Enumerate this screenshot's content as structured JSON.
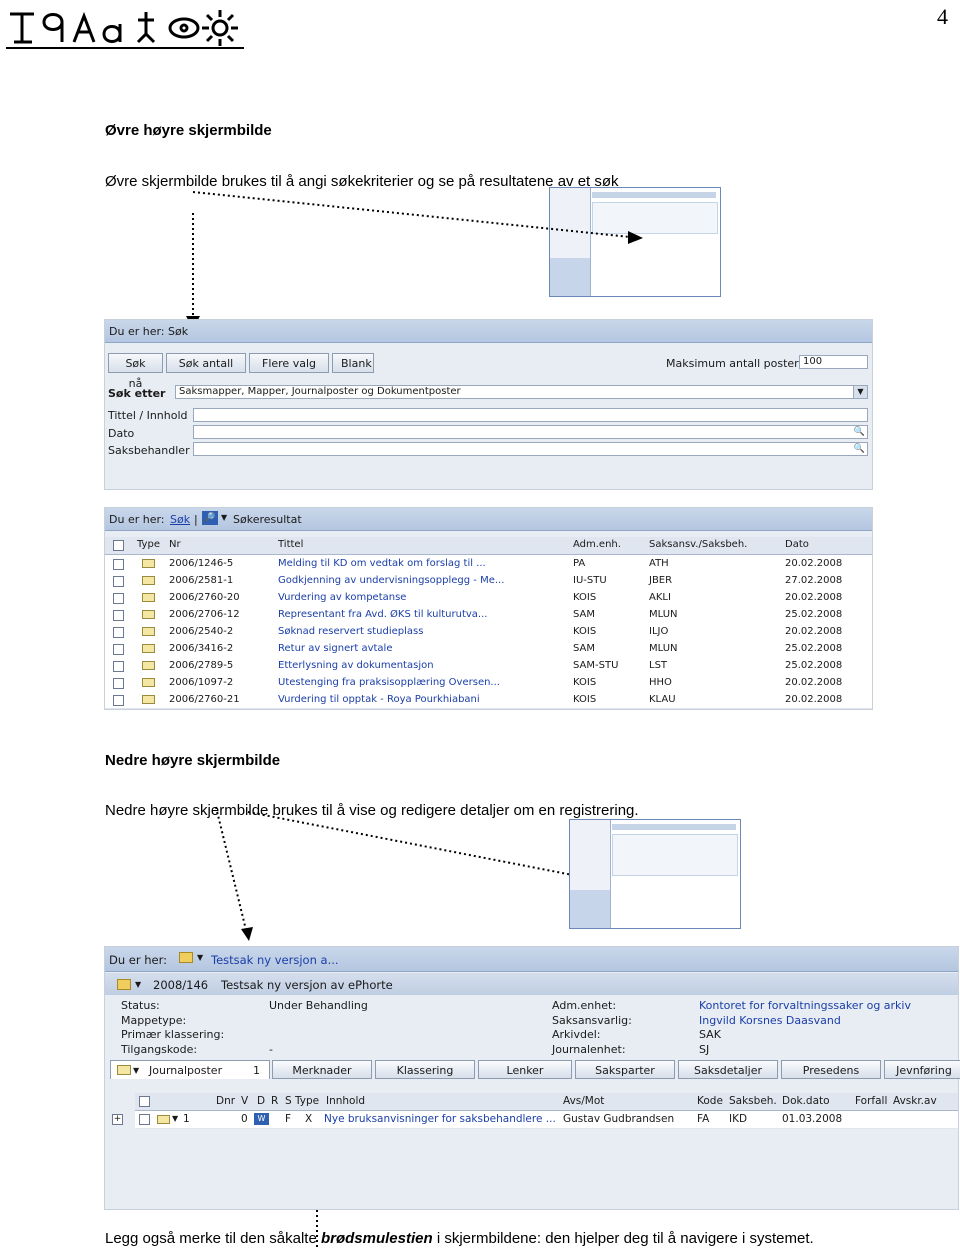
{
  "page_number": "4",
  "section1": {
    "heading": "Øvre høyre skjermbilde",
    "text": "Øvre skjermbilde brukes til å angi søkekriterier og se på resultatene av et søk"
  },
  "search_panel": {
    "breadcrumb": "Du er her: Søk",
    "buttons": [
      "Søk nå",
      "Søk antall",
      "Flere valg",
      "Blank"
    ],
    "max_label": "Maksimum antall poster",
    "max_value": "100",
    "search_for_label": "Søk etter",
    "search_for_value": "Saksmapper, Mapper, Journalposter og Dokumentposter",
    "fields": [
      "Tittel / Innhold",
      "Dato",
      "Saksbehandler"
    ]
  },
  "results_panel": {
    "breadcrumb_prefix": "Du er her:",
    "breadcrumb_link": "Søk",
    "breadcrumb_sep": "|",
    "breadcrumb_current": "Søkeresultat",
    "columns": [
      "Type",
      "Nr",
      "Tittel",
      "Adm.enh.",
      "Saksansv./Saksbeh.",
      "Dato"
    ],
    "rows": [
      {
        "nr": "2006/1246-5",
        "tittel": "Melding til KD om vedtak om forslag til ...",
        "adm": "PA",
        "saksbeh": "ATH",
        "dato": "20.02.2008"
      },
      {
        "nr": "2006/2581-1",
        "tittel": "Godkjenning av undervisningsopplegg - Me...",
        "adm": "IU-STU",
        "saksbeh": "JBER",
        "dato": "27.02.2008"
      },
      {
        "nr": "2006/2760-20",
        "tittel": "Vurdering av kompetanse",
        "adm": "KOIS",
        "saksbeh": "AKLI",
        "dato": "20.02.2008"
      },
      {
        "nr": "2006/2706-12",
        "tittel": "Representant fra Avd. ØKS til kulturutva...",
        "adm": "SAM",
        "saksbeh": "MLUN",
        "dato": "25.02.2008"
      },
      {
        "nr": "2006/2540-2",
        "tittel": "Søknad reservert studieplass",
        "adm": "KOIS",
        "saksbeh": "ILJO",
        "dato": "20.02.2008"
      },
      {
        "nr": "2006/3416-2",
        "tittel": "Retur av signert avtale",
        "adm": "SAM",
        "saksbeh": "MLUN",
        "dato": "25.02.2008"
      },
      {
        "nr": "2006/2789-5",
        "tittel": "Etterlysning av dokumentasjon",
        "adm": "SAM-STU",
        "saksbeh": "LST",
        "dato": "25.02.2008"
      },
      {
        "nr": "2006/1097-2",
        "tittel": "Utestenging fra praksisopplæring Oversen...",
        "adm": "KOIS",
        "saksbeh": "HHO",
        "dato": "20.02.2008"
      },
      {
        "nr": "2006/2760-21",
        "tittel": "Vurdering til opptak - Roya Pourkhiabani",
        "adm": "KOIS",
        "saksbeh": "KLAU",
        "dato": "20.02.2008"
      }
    ]
  },
  "section2": {
    "heading": "Nedre høyre skjermbilde",
    "text": "Nedre høyre skjermbilde brukes til å vise og redigere detaljer om en registrering."
  },
  "detail_panel": {
    "breadcrumb_prefix": "Du er her:",
    "breadcrumb_link": "Testsak ny versjon a...",
    "case_number": "2008/146",
    "case_title": "Testsak ny versjon av ePhorte",
    "left_labels": [
      "Status:",
      "Mappetype:",
      "Primær klassering:",
      "Tilgangskode:"
    ],
    "left_values": [
      "Under Behandling",
      "",
      "",
      "-"
    ],
    "right_labels": [
      "Adm.enhet:",
      "Saksansvarlig:",
      "Arkivdel:",
      "Journalenhet:"
    ],
    "right_values": [
      "Kontoret for forvaltningssaker og arkiv",
      "Ingvild Korsnes Daasvand",
      "SAK",
      "SJ"
    ],
    "tabs": [
      "Journalposter",
      "Merknader",
      "Klassering",
      "Lenker",
      "Saksparter",
      "Saksdetaljer",
      "Presedens",
      "Jevnføring"
    ],
    "tab_count": "1",
    "columns": [
      "Dnr",
      "V",
      "D",
      "R",
      "S",
      "Type",
      "Innhold",
      "Avs/Mot",
      "Kode",
      "Saksbeh.",
      "Dok.dato",
      "Forfall",
      "Avskr.av"
    ],
    "row": {
      "dnr": "1",
      "v": "0",
      "type": "X",
      "s": "F",
      "innhold": "Nye bruksanvisninger for saksbehandlere ...",
      "avs": "Gustav Gudbrandsen",
      "kode": "FA",
      "saksbeh": "IKD",
      "dato": "01.03.2008"
    }
  },
  "footer": {
    "pre": "Legg også merke til den såkalte ",
    "em": "brødsmulestien",
    "post": " i skjermbildene: den hjelper deg til å navigere i systemet."
  }
}
